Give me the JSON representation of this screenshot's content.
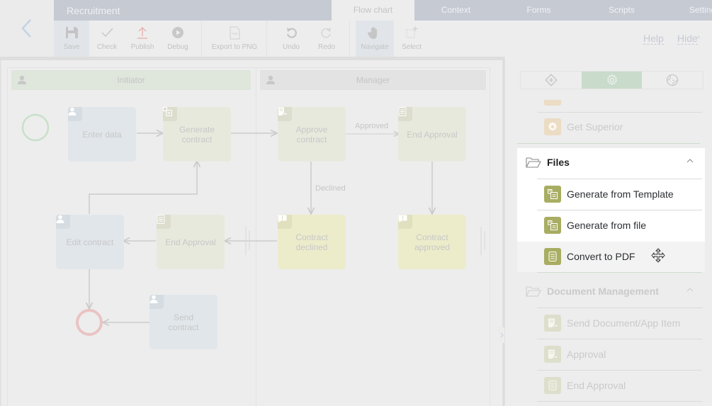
{
  "app": {
    "title": "Recruitment",
    "back_icon": "chevron-left-icon"
  },
  "tabs": [
    {
      "label": "Flow chart",
      "active": true
    },
    {
      "label": "Context",
      "active": false
    },
    {
      "label": "Forms",
      "active": false
    },
    {
      "label": "Scripts",
      "active": false
    },
    {
      "label": "Settings",
      "active": false
    }
  ],
  "toolbar": {
    "save": "Save",
    "check": "Check",
    "publish": "Publish",
    "debug": "Debug",
    "export_png": "Export to PNG",
    "undo": "Undo",
    "redo": "Redo",
    "navigate": "Navigate",
    "select": "Select",
    "help": "Help",
    "hide": "Hide",
    "hide_chevron": "^"
  },
  "colors": {
    "accent_green": "#c9dbcb",
    "publish_red": "#eab4b0",
    "start_event": "#c8e0c9",
    "end_event": "#ebc3c3",
    "file_icon_bg": "#a8ad62"
  },
  "flowchart": {
    "lanes": [
      {
        "name": "Initiator",
        "icon": "user-icon"
      },
      {
        "name": "Manager",
        "icon": "user-icon"
      }
    ],
    "nodes": {
      "enter_data": "Enter data",
      "generate_contract_1": "Generate",
      "generate_contract_2": "contract",
      "approve_contract_1": "Approve",
      "approve_contract_2": "contract",
      "end_approval_top": "End Approval",
      "edit_contract": "Edit contract",
      "end_approval_mid": "End Approval",
      "contract_declined_1": "Contract",
      "contract_declined_2": "declined",
      "contract_approved_1": "Contract",
      "contract_approved_2": "approved",
      "send_contract_1": "Send",
      "send_contract_2": "contract"
    },
    "edge_labels": {
      "approved": "Approved",
      "declined": "Declined"
    }
  },
  "panel": {
    "segments": [
      {
        "icon": "add-node-icon",
        "active": false
      },
      {
        "icon": "gear-icon",
        "active": true
      },
      {
        "icon": "globe-icon",
        "active": false
      }
    ],
    "items_above": [
      {
        "label": "Get Superior",
        "icon": "gear-icon"
      }
    ],
    "groups": [
      {
        "label": "Files",
        "expanded": true,
        "items": [
          {
            "label": "Generate from Template",
            "icon": "template-doc-icon"
          },
          {
            "label": "Generate from file",
            "icon": "template-doc-icon"
          },
          {
            "label": "Convert to PDF",
            "icon": "scroll-doc-icon"
          }
        ]
      },
      {
        "label": "Document Management",
        "expanded": true,
        "items": [
          {
            "label": "Send Document/App Item",
            "icon": "send-doc-icon"
          },
          {
            "label": "Approval",
            "icon": "send-doc-icon"
          },
          {
            "label": "End Approval",
            "icon": "scroll-doc-icon"
          }
        ]
      }
    ]
  }
}
